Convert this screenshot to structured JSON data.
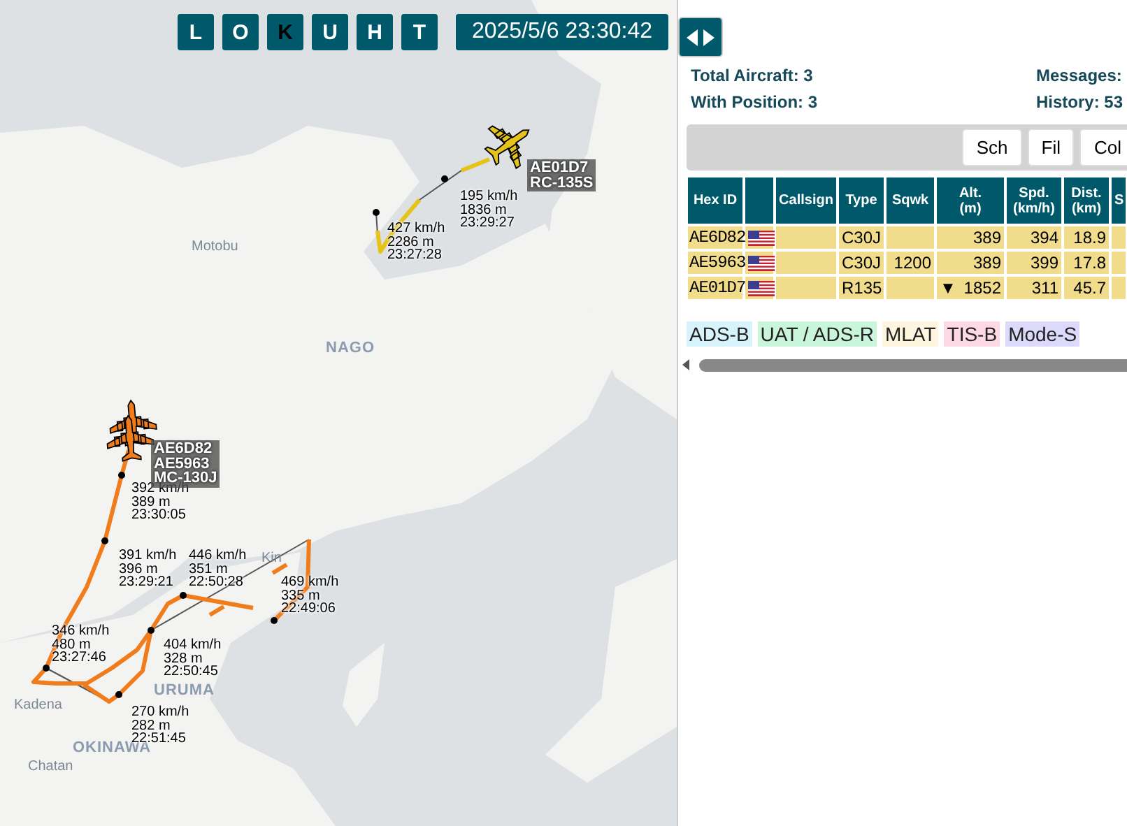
{
  "map": {
    "toolbar": {
      "buttons": [
        {
          "label": "L",
          "selected": false
        },
        {
          "label": "O",
          "selected": false
        },
        {
          "label": "K",
          "selected": true
        },
        {
          "label": "U",
          "selected": false
        },
        {
          "label": "H",
          "selected": false
        },
        {
          "label": "T",
          "selected": false
        }
      ],
      "clock": "2025/5/6 23:30:42"
    },
    "place_labels": [
      "Motobu",
      "NAGO",
      "Kin",
      "URUMA",
      "Kadena",
      "OKINAWA",
      "Chatan"
    ],
    "aircraft": [
      {
        "color": "#e6c31b"
      },
      {
        "color": "#f07c1c"
      },
      {
        "color": "#f07c1c"
      }
    ],
    "aircraft_labels": [
      [
        "AE01D7",
        "RC-135S"
      ],
      [
        "AE6D82",
        "AE5963",
        "MC-130J"
      ]
    ],
    "track_points": [
      {
        "speed": "427 km/h",
        "altitude": "2286 m",
        "time": "23:27:28"
      },
      {
        "speed": "195 km/h",
        "altitude": "1836 m",
        "time": "23:29:27"
      },
      {
        "speed": "392 km/h",
        "altitude": "389 m",
        "time": "23:30:05"
      },
      {
        "speed": "391 km/h",
        "altitude": "396 m",
        "time": "23:29:21"
      },
      {
        "speed": "446 km/h",
        "altitude": "351 m",
        "time": "22:50:28"
      },
      {
        "speed": "469 km/h",
        "altitude": "335 m",
        "time": "22:49:06"
      },
      {
        "speed": "346 km/h",
        "altitude": "480 m",
        "time": "23:27:46"
      },
      {
        "speed": "404 km/h",
        "altitude": "328 m",
        "time": "22:50:45"
      },
      {
        "speed": "270 km/h",
        "altitude": "282 m",
        "time": "22:51:45"
      }
    ]
  },
  "sidebar": {
    "stats": [
      [
        "Total Aircraft: 3",
        "Messages:"
      ],
      [
        "With Position: 3",
        "History: 53"
      ]
    ],
    "buttons": [
      "Sch",
      "Fil",
      "Col"
    ],
    "table": {
      "columns": [
        "Hex ID",
        "",
        "Callsign",
        "Type",
        "Sqwk",
        "Alt.\n(m)",
        "Spd.\n(km/h)",
        "Dist.\n(km)",
        "S"
      ],
      "rows": [
        {
          "hex": "AE6D82",
          "type": "C30J",
          "altitude": "389",
          "speed": "394",
          "distance": "18.9"
        },
        {
          "hex": "AE5963",
          "type": "C30J",
          "squawk": "1200",
          "altitude": "389",
          "speed": "399",
          "distance": "17.8"
        },
        {
          "hex": "AE01D7",
          "type": "R135",
          "vertical": "▼",
          "altitude": "1852",
          "speed": "311",
          "distance": "45.7"
        }
      ]
    },
    "legend": [
      {
        "label": "ADS-B",
        "color": "#d7f3fc"
      },
      {
        "label": "UAT / ADS-R",
        "color": "#c9f5da"
      },
      {
        "label": "MLAT",
        "color": "#fdf5dd"
      },
      {
        "label": "TIS-B",
        "color": "#fdd9e6"
      },
      {
        "label": "Mode-S",
        "color": "#dcd9fb"
      }
    ]
  }
}
